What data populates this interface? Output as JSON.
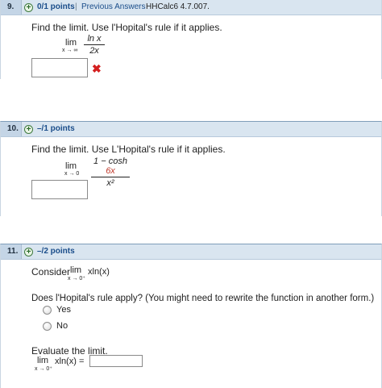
{
  "questions": [
    {
      "number": "9.",
      "points": "0/1 points",
      "separator": "|",
      "previous_answers": "Previous Answers",
      "code": "HHCalc6 4.7.007.",
      "prompt": "Find the limit. Use l'Hopital's rule if it applies.",
      "lim": "lim",
      "lim_sub": "x → ∞",
      "numerator": "ln x",
      "denominator": "2x",
      "answer_value": "",
      "status": "incorrect",
      "status_icon": "✖"
    },
    {
      "number": "10.",
      "points": "–/1 points",
      "prompt": "Find the limit. Use L'Hopital's rule if it applies.",
      "lim": "lim",
      "lim_sub": "x → 0",
      "numerator_prefix": "1 − cosh ",
      "numerator_highlight": "6x",
      "denominator": "x²",
      "answer_value": ""
    },
    {
      "number": "11.",
      "points": "–/2 points",
      "consider": "Consider",
      "lim": "lim",
      "lim_sub": "x → 0⁺",
      "expr": "xln(x)",
      "question": "Does l'Hopital's rule apply? (You might need to rewrite the function in another form.)",
      "options": [
        "Yes",
        "No"
      ],
      "evaluate": "Evaluate the limit.",
      "eval_expr": "xln(x)  =",
      "answer_value": ""
    }
  ],
  "colors": {
    "header_bg": "#d9e5f0",
    "points_text": "#1a4d8a",
    "incorrect": "#d42020",
    "highlight": "#c0392b"
  }
}
